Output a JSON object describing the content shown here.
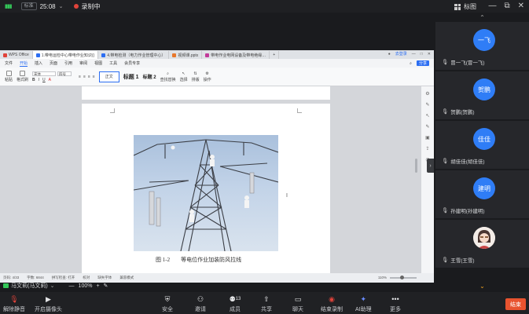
{
  "topbar": {
    "net_badge": "标准",
    "time": "25:08",
    "recording_label": "录制中",
    "view_label": "标图"
  },
  "wps": {
    "tabs": [
      {
        "label": "WPS Office",
        "color": "#e0433a"
      },
      {
        "label": "1.带电运检中心带电作业知识()",
        "color": "#2c6ef2"
      },
      {
        "label": "4.带电检测（电力作业管理中心）",
        "color": "#2c6ef2"
      },
      {
        "label": "视频课.pptx",
        "color": "#e8782c"
      },
      {
        "label": "带电作业电网设备及带电绝缘…",
        "color": "#c23a9a"
      }
    ],
    "login_label": "去登录",
    "menu": [
      "文件",
      "开始",
      "插入",
      "页面",
      "引用",
      "审阅",
      "视图",
      "工具",
      "会员专享"
    ],
    "active_menu": "开始",
    "share_label": "分享",
    "ribbon": {
      "font_name": "宋体",
      "font_size": "四号",
      "style_normal": "正文",
      "style_h1": "标题 1",
      "style_h2": "标题 2",
      "paste": "粘贴",
      "format_painter": "格式刷",
      "find_replace": "查找替换",
      "select": "选择",
      "sort": "排版",
      "ops": "操作"
    },
    "caption": "图 1-2        等电位作业加装防风拉线",
    "status": {
      "page": "页码: 4/33",
      "words": "字数: 6844",
      "spell": "拼写检查: 打开",
      "proof": "校对",
      "missing_font": "缺失字体",
      "compat": "兼容模式",
      "zoom": "110%"
    }
  },
  "participants": [
    {
      "avatar": "一飞",
      "name": "冒一飞(冒一飞)",
      "kind": "text"
    },
    {
      "avatar": "贺鹏",
      "name": "贺鹏(贺鹏)",
      "kind": "text"
    },
    {
      "avatar": "佳佳",
      "name": "胡佳佳(胡佳佳)",
      "kind": "text"
    },
    {
      "avatar": "建明",
      "name": "孙建明(孙建明)",
      "kind": "text"
    },
    {
      "avatar": "",
      "name": "王雪(王雪)",
      "kind": "photo"
    }
  ],
  "subbar": {
    "sharer": "马文莉(马文莉)",
    "zoom_minus": "—",
    "zoom_value": "100%",
    "zoom_plus": "+"
  },
  "toolbar": {
    "unmute": "解除静音",
    "camera": "开启摄像头",
    "security": "安全",
    "invite": "邀请",
    "members": "成员",
    "member_count": "13",
    "share": "共享",
    "chat": "聊天",
    "stop_record": "结束录制",
    "ai": "AI助理",
    "more": "更多",
    "end": "结束"
  }
}
